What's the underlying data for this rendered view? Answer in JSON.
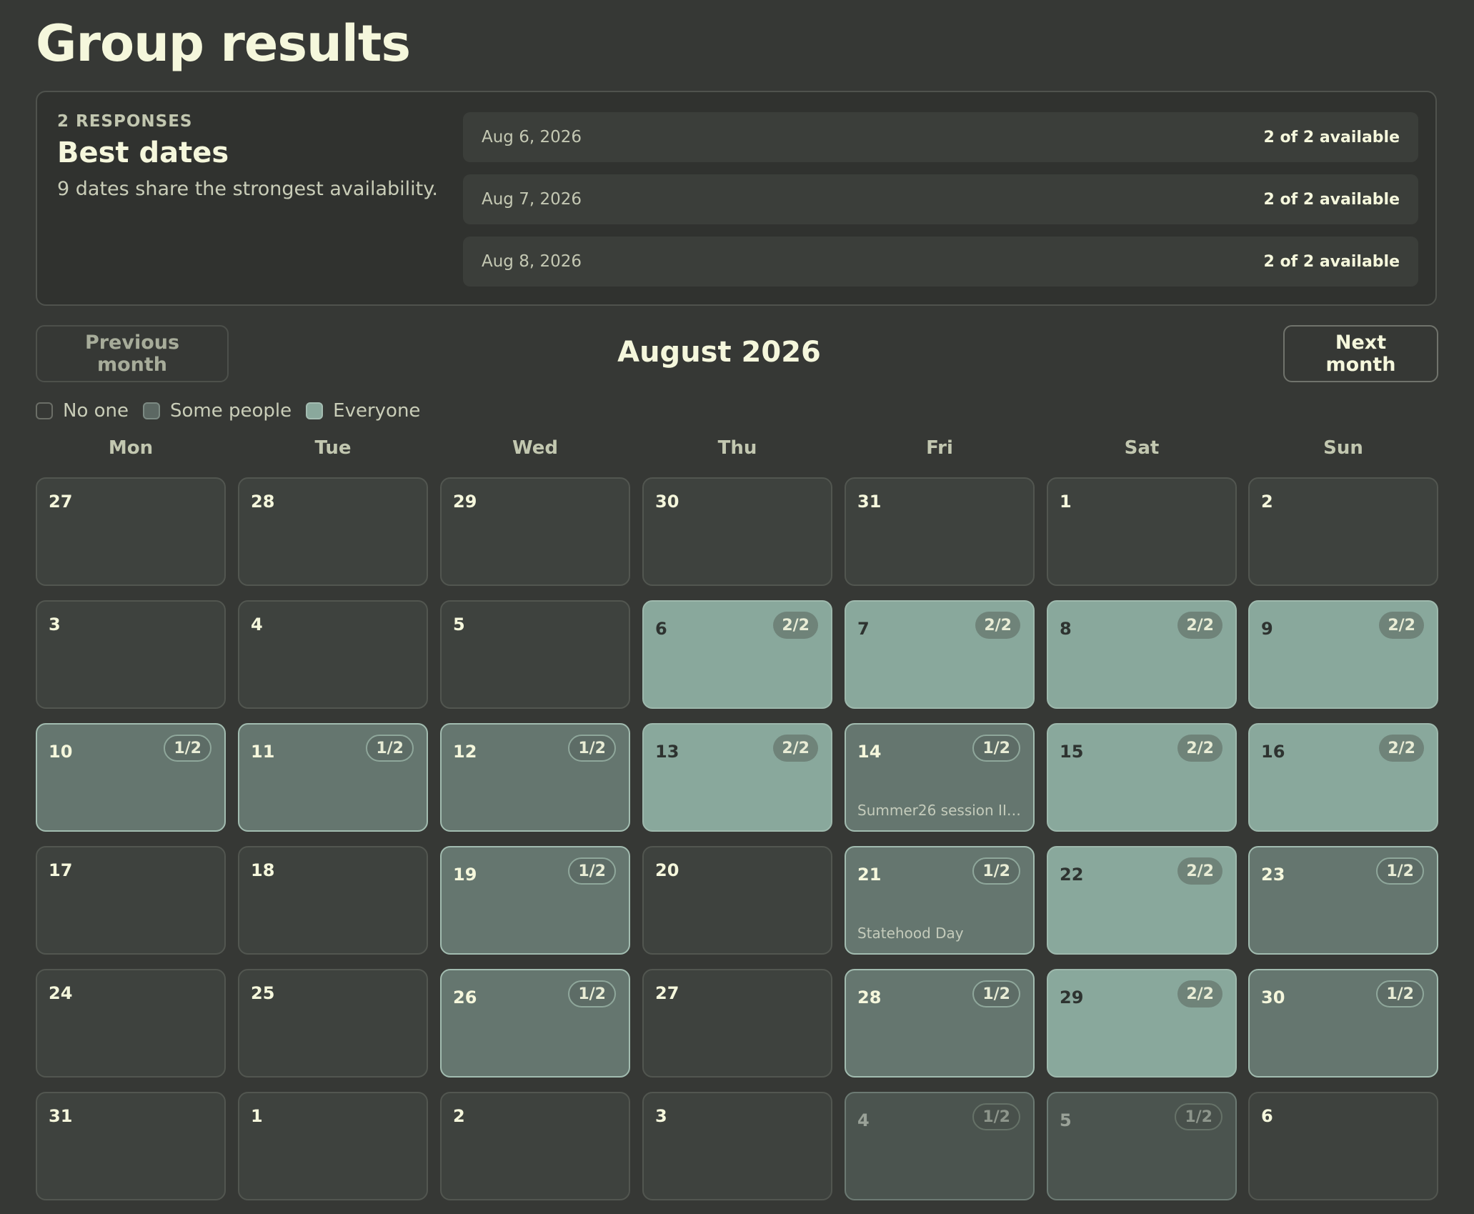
{
  "page": {
    "title": "Group results"
  },
  "summary": {
    "responses_label": "2 RESPONSES",
    "title": "Best dates",
    "subtitle": "9 dates share the strongest availability.",
    "best": [
      {
        "date": "Aug 6, 2026",
        "availability": "2 of 2 available"
      },
      {
        "date": "Aug 7, 2026",
        "availability": "2 of 2 available"
      },
      {
        "date": "Aug 8, 2026",
        "availability": "2 of 2 available"
      }
    ]
  },
  "nav": {
    "prev_label": "Previous month",
    "next_label": "Next month",
    "month_title": "August 2026"
  },
  "legend": {
    "none": "No one",
    "some": "Some people",
    "all": "Everyone"
  },
  "weekdays": [
    "Mon",
    "Tue",
    "Wed",
    "Thu",
    "Fri",
    "Sat",
    "Sun"
  ],
  "days": [
    {
      "num": "27",
      "state": "none",
      "other": true,
      "badge": "",
      "note": ""
    },
    {
      "num": "28",
      "state": "none",
      "other": true,
      "badge": "",
      "note": ""
    },
    {
      "num": "29",
      "state": "none",
      "other": true,
      "badge": "",
      "note": ""
    },
    {
      "num": "30",
      "state": "none",
      "other": true,
      "badge": "",
      "note": ""
    },
    {
      "num": "31",
      "state": "none",
      "other": true,
      "badge": "",
      "note": ""
    },
    {
      "num": "1",
      "state": "none",
      "other": true,
      "badge": "",
      "note": ""
    },
    {
      "num": "2",
      "state": "none",
      "other": true,
      "badge": "",
      "note": ""
    },
    {
      "num": "3",
      "state": "none",
      "other": true,
      "badge": "",
      "note": ""
    },
    {
      "num": "4",
      "state": "none",
      "other": true,
      "badge": "",
      "note": ""
    },
    {
      "num": "5",
      "state": "none",
      "other": true,
      "badge": "",
      "note": ""
    },
    {
      "num": "6",
      "state": "all",
      "other": false,
      "badge": "2/2",
      "note": ""
    },
    {
      "num": "7",
      "state": "all",
      "other": false,
      "badge": "2/2",
      "note": ""
    },
    {
      "num": "8",
      "state": "all",
      "other": false,
      "badge": "2/2",
      "note": ""
    },
    {
      "num": "9",
      "state": "all",
      "other": false,
      "badge": "2/2",
      "note": ""
    },
    {
      "num": "10",
      "state": "some",
      "other": false,
      "badge": "1/2",
      "note": ""
    },
    {
      "num": "11",
      "state": "some",
      "other": false,
      "badge": "1/2",
      "note": ""
    },
    {
      "num": "12",
      "state": "some",
      "other": false,
      "badge": "1/2",
      "note": ""
    },
    {
      "num": "13",
      "state": "all",
      "other": false,
      "badge": "2/2",
      "note": ""
    },
    {
      "num": "14",
      "state": "some",
      "other": false,
      "badge": "1/2",
      "note": "Summer26 session II ..."
    },
    {
      "num": "15",
      "state": "all",
      "other": false,
      "badge": "2/2",
      "note": ""
    },
    {
      "num": "16",
      "state": "all",
      "other": false,
      "badge": "2/2",
      "note": ""
    },
    {
      "num": "17",
      "state": "none",
      "other": false,
      "badge": "",
      "note": ""
    },
    {
      "num": "18",
      "state": "none",
      "other": false,
      "badge": "",
      "note": ""
    },
    {
      "num": "19",
      "state": "some",
      "other": false,
      "badge": "1/2",
      "note": ""
    },
    {
      "num": "20",
      "state": "none",
      "other": false,
      "badge": "",
      "note": ""
    },
    {
      "num": "21",
      "state": "some",
      "other": false,
      "badge": "1/2",
      "note": "Statehood Day"
    },
    {
      "num": "22",
      "state": "all",
      "other": false,
      "badge": "2/2",
      "note": ""
    },
    {
      "num": "23",
      "state": "some",
      "other": false,
      "badge": "1/2",
      "note": ""
    },
    {
      "num": "24",
      "state": "none",
      "other": false,
      "badge": "",
      "note": ""
    },
    {
      "num": "25",
      "state": "none",
      "other": false,
      "badge": "",
      "note": ""
    },
    {
      "num": "26",
      "state": "some",
      "other": false,
      "badge": "1/2",
      "note": ""
    },
    {
      "num": "27",
      "state": "none",
      "other": false,
      "badge": "",
      "note": ""
    },
    {
      "num": "28",
      "state": "some",
      "other": false,
      "badge": "1/2",
      "note": ""
    },
    {
      "num": "29",
      "state": "all",
      "other": false,
      "badge": "2/2",
      "note": ""
    },
    {
      "num": "30",
      "state": "some",
      "other": false,
      "badge": "1/2",
      "note": ""
    },
    {
      "num": "31",
      "state": "none",
      "other": false,
      "badge": "",
      "note": ""
    },
    {
      "num": "1",
      "state": "none",
      "other": true,
      "badge": "",
      "note": ""
    },
    {
      "num": "2",
      "state": "none",
      "other": true,
      "badge": "",
      "note": ""
    },
    {
      "num": "3",
      "state": "none",
      "other": true,
      "badge": "",
      "note": ""
    },
    {
      "num": "4",
      "state": "some",
      "other": true,
      "badge": "1/2",
      "note": ""
    },
    {
      "num": "5",
      "state": "some",
      "other": true,
      "badge": "1/2",
      "note": ""
    },
    {
      "num": "6",
      "state": "none",
      "other": true,
      "badge": "",
      "note": ""
    }
  ],
  "colors": {
    "background": "#363835",
    "everyone": "#89a89c",
    "some_people": "#65766f",
    "text_primary": "#f5f7dc"
  }
}
